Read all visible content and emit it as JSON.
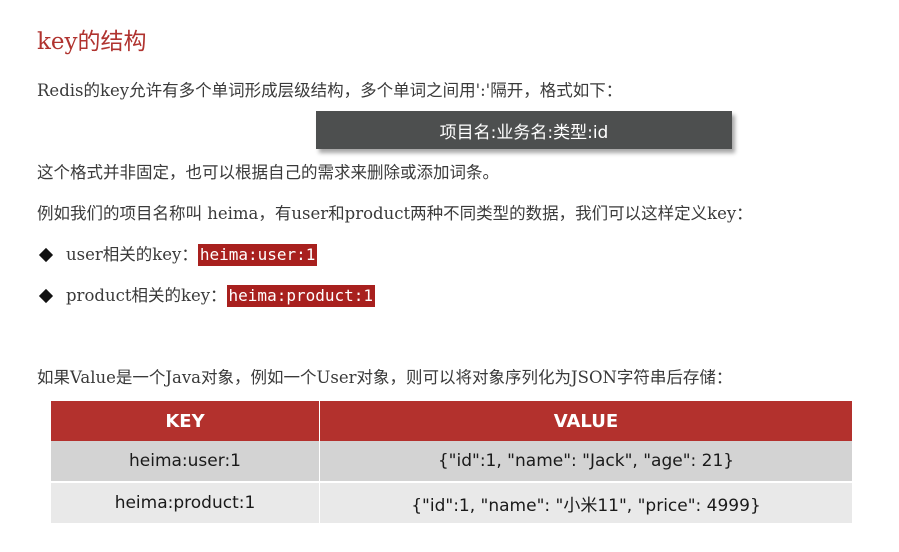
{
  "heading": "key的结构",
  "intro": "Redis的key允许有多个单词形成层级结构，多个单词之间用':'隔开，格式如下：",
  "format_box": "项目名:业务名:类型:id",
  "note": "这个格式并非固定，也可以根据自己的需求来删除或添加词条。",
  "example_intro": "例如我们的项目名称叫 heima，有user和product两种不同类型的数据，我们可以这样定义key：",
  "bullets": [
    {
      "label": "user相关的key：",
      "code": "heima:user:1"
    },
    {
      "label": "product相关的key：",
      "code": "heima:product:1"
    }
  ],
  "value_intro": "如果Value是一个Java对象，例如一个User对象，则可以将对象序列化为JSON字符串后存储：",
  "table": {
    "headers": [
      "KEY",
      "VALUE"
    ],
    "rows": [
      [
        "heima:user:1",
        "{\"id\":1, \"name\": \"Jack\", \"age\": 21}"
      ],
      [
        "heima:product:1",
        "{\"id\":1, \"name\": \"小米11\", \"price\": 4999}"
      ]
    ]
  },
  "colors": {
    "heading": "#b0332f",
    "highlight": "#a8201e",
    "table_header": "#b3312d",
    "format_box": "#4d4f4f"
  }
}
